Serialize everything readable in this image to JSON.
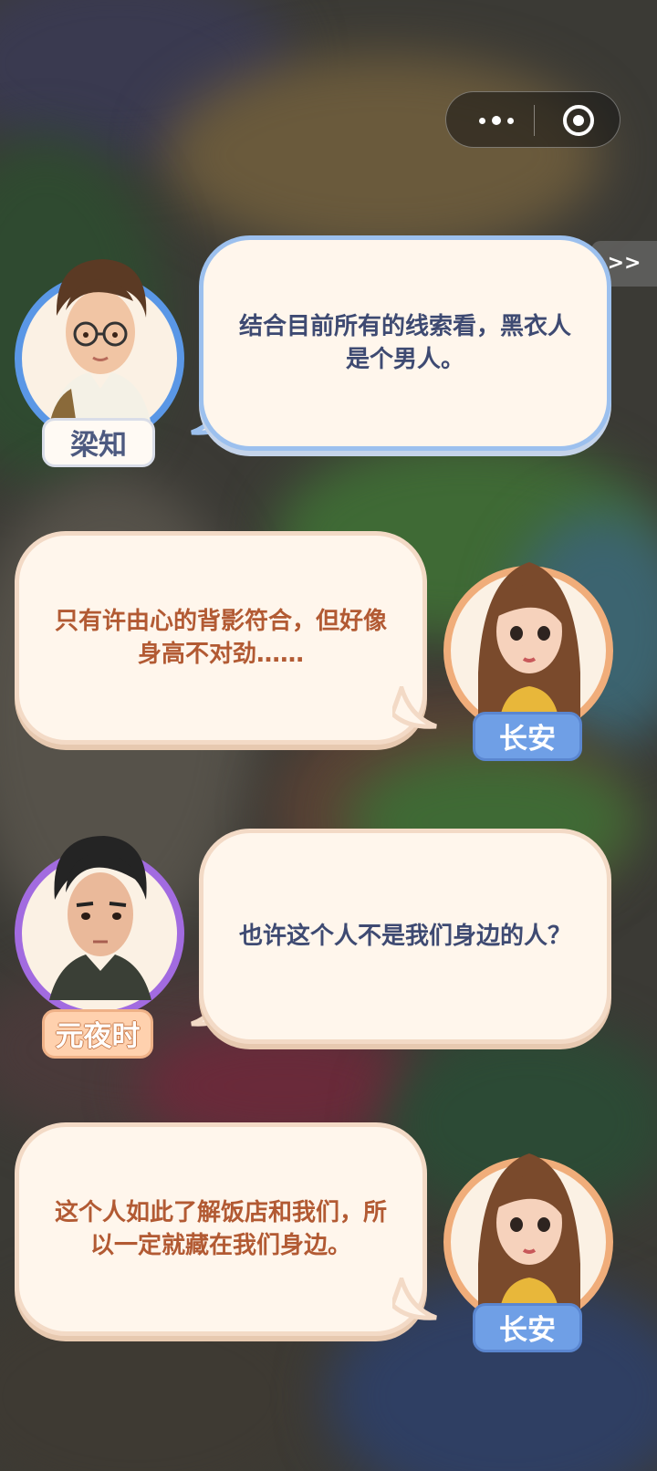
{
  "toolbar": {
    "skip_label": ">>"
  },
  "messages": [
    {
      "speaker": "梁知",
      "text": "结合目前所有的线索看，黑衣人是个男人。"
    },
    {
      "speaker": "长安",
      "text": "只有许由心的背影符合，但好像身高不对劲……"
    },
    {
      "speaker": "元夜时",
      "text": "也许这个人不是我们身边的人？"
    },
    {
      "speaker": "长安",
      "text": "这个人如此了解饭店和我们，所以一定就藏在我们身边。"
    }
  ],
  "colors": {
    "bubble_fill": "#fff6ec",
    "blue_ring": "#5a97e6",
    "orange_ring": "#f0ad7a",
    "purple_ring": "#a26be0"
  }
}
